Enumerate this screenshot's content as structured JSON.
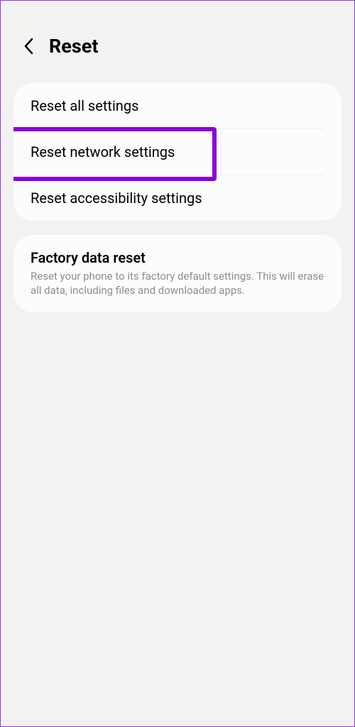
{
  "header": {
    "title": "Reset"
  },
  "card1": {
    "items": [
      {
        "title": "Reset all settings"
      },
      {
        "title": "Reset network settings"
      },
      {
        "title": "Reset accessibility settings"
      }
    ]
  },
  "card2": {
    "items": [
      {
        "title": "Factory data reset",
        "description": "Reset your phone to its factory default settings. This will erase all data, including files and downloaded apps."
      }
    ]
  }
}
